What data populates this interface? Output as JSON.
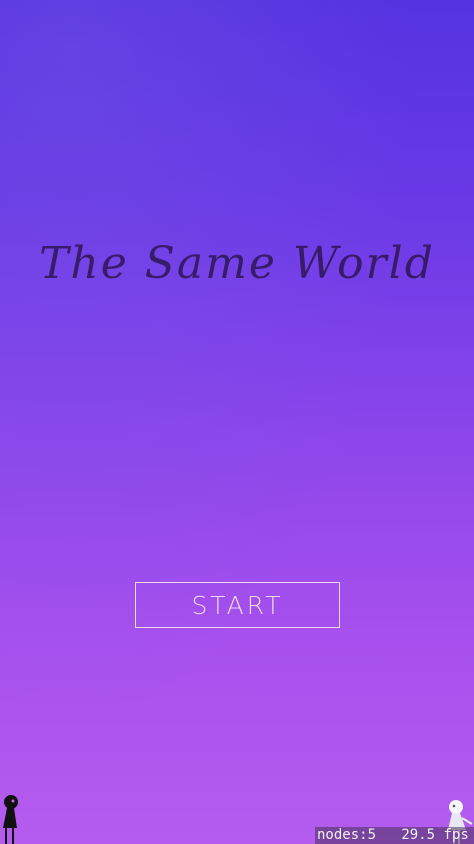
{
  "game": {
    "title": "The Same World",
    "start_label": "START"
  },
  "debug": {
    "nodes": "nodes:5",
    "fps": "29.5 fps"
  },
  "characters": {
    "left": "dark-silhouette-character",
    "right": "white-silhouette-character"
  },
  "colors": {
    "background_top": "#5433e0",
    "background_bottom": "#b55cef",
    "title": "#34185f",
    "button_border": "#f2d8ea"
  }
}
